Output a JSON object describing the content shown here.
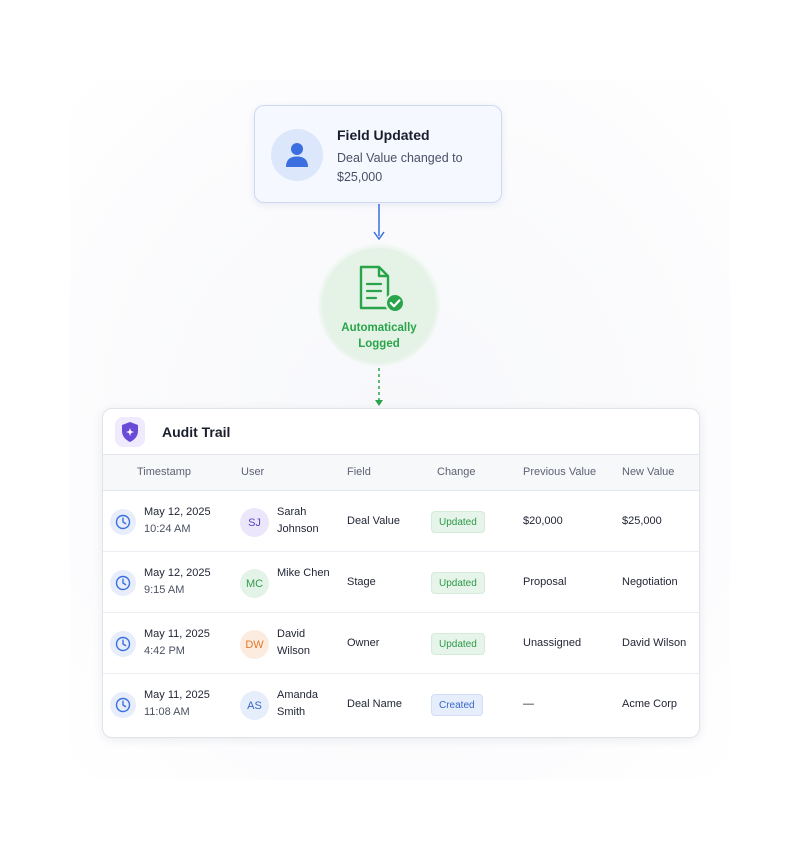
{
  "event_card": {
    "title": "Field Updated",
    "description": "Deal Value changed to $25,000"
  },
  "logged_badge": {
    "text": "Automatically Logged"
  },
  "audit": {
    "title": "Audit Trail",
    "columns": [
      "Timestamp",
      "User",
      "Field",
      "Change",
      "Previous Value",
      "New Value"
    ],
    "rows": [
      {
        "date": "May 12, 2025",
        "time": "10:24 AM",
        "initials": "SJ",
        "user": "Sarah Johnson",
        "field": "Deal Value",
        "change": "Updated",
        "previous": "$20,000",
        "new": "$25,000"
      },
      {
        "date": "May 12, 2025",
        "time": "9:15 AM",
        "initials": "MC",
        "user": "Mike Chen",
        "field": "Stage",
        "change": "Updated",
        "previous": "Proposal",
        "new": "Negotiation"
      },
      {
        "date": "May 11, 2025",
        "time": "4:42 PM",
        "initials": "DW",
        "user": "David Wilson",
        "field": "Owner",
        "change": "Updated",
        "previous": "Unassigned",
        "new": "David Wilson"
      },
      {
        "date": "May 11, 2025",
        "time": "11:08 AM",
        "initials": "AS",
        "user": "Amanda Smith",
        "field": "Deal Name",
        "change": "Created",
        "previous": "—",
        "new": "Acme Corp"
      }
    ]
  },
  "colors": {
    "accent_blue": "#3b6fe0",
    "logged_green": "#2aa44b",
    "shield_purple": "#6a4bd8",
    "avatar_sj": "#ece6fb",
    "avatar_mc": "#e4f3e7",
    "avatar_dw": "#fcece0",
    "avatar_as": "#e6eefb"
  },
  "icons": {
    "event": "user-icon",
    "logged": "document-check-icon",
    "audit": "shield-icon",
    "row": "clock-icon"
  }
}
